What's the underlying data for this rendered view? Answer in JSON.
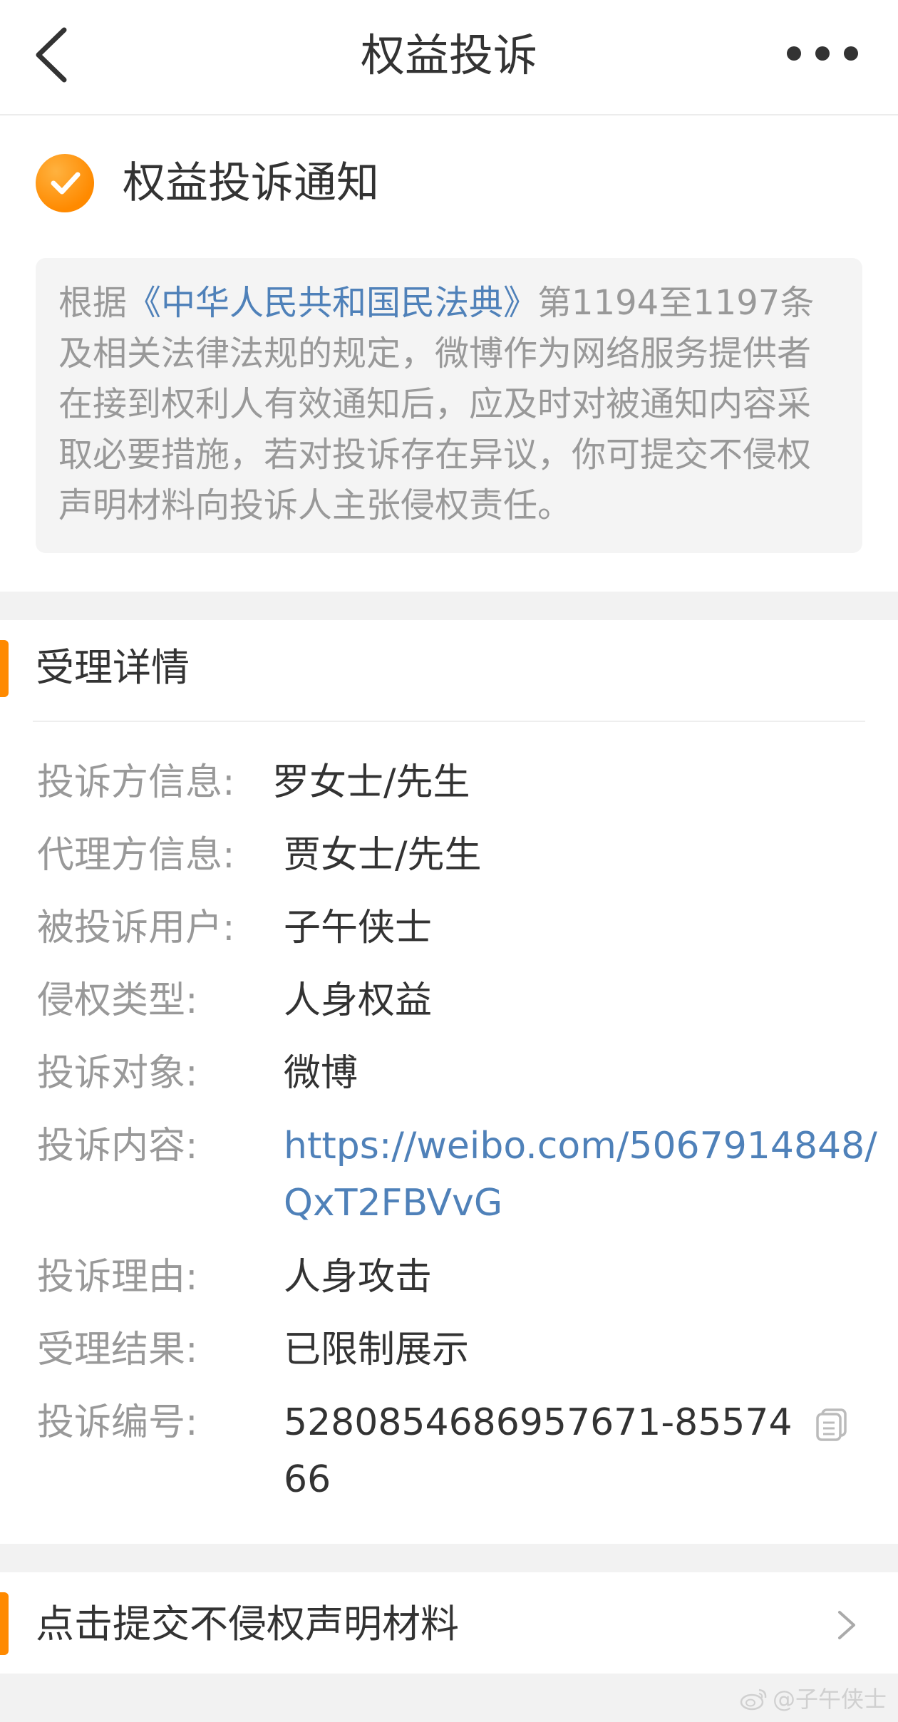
{
  "header": {
    "title": "权益投诉"
  },
  "notice": {
    "title": "权益投诉通知",
    "text_prefix": "根据",
    "law_link": "《中华人民共和国民法典》",
    "text_rest": "第1194至1197条及相关法律法规的规定，微博作为网络服务提供者在接到权利人有效通知后，应及时对被通知内容采取必要措施，若对投诉存在异议，你可提交不侵权声明材料向投诉人主张侵权责任。"
  },
  "details": {
    "section_title": "受理详情",
    "rows": [
      {
        "label": "投诉方信息:",
        "value": "罗女士/先生"
      },
      {
        "label": "代理方信息:",
        "value": "贾女士/先生"
      },
      {
        "label": "被投诉用户:",
        "value": "子午侠士"
      },
      {
        "label": "侵权类型:",
        "value": "人身权益"
      },
      {
        "label": "投诉对象:",
        "value": "微博"
      },
      {
        "label": "投诉内容:",
        "value": "https://weibo.com/5067914848/QxT2FBVvG"
      },
      {
        "label": "投诉理由:",
        "value": "人身攻击"
      },
      {
        "label": "受理结果:",
        "value": "已限制展示"
      },
      {
        "label": "投诉编号:",
        "value": "5280854686957671-8557466"
      }
    ]
  },
  "submit": {
    "label": "点击提交不侵权声明材料"
  },
  "watermark": {
    "text": "@子午侠士"
  },
  "colors": {
    "accent": "#ff8a00",
    "link": "#4f81b9",
    "label": "#999999",
    "text": "#333333"
  },
  "icons": {
    "back": "chevron-left-icon",
    "more": "more-dots-icon",
    "check": "check-circle-icon",
    "copy": "copy-icon",
    "forward": "chevron-right-icon",
    "weibo": "weibo-logo-icon"
  }
}
